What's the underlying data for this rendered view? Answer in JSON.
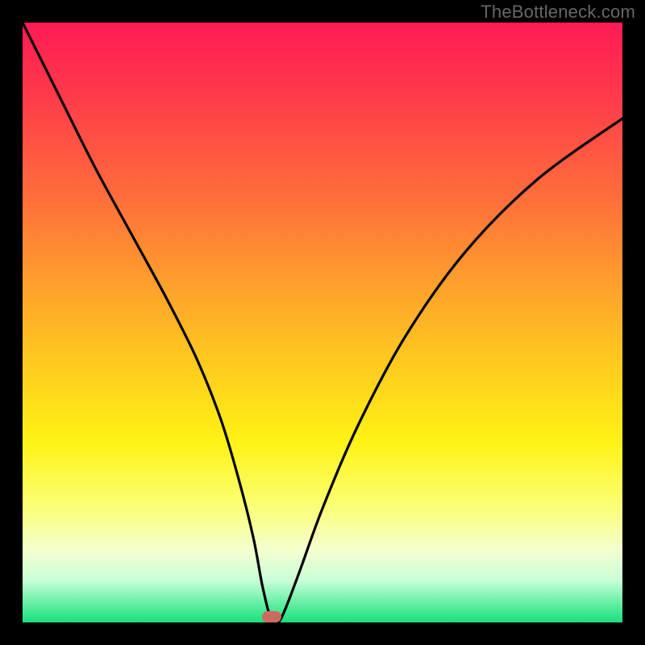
{
  "watermark_text": "TheBottleneck.com",
  "marker": {
    "x_pct": 41.5,
    "y_pct": 99.0,
    "color": "#cc6a60"
  },
  "chart_data": {
    "type": "line",
    "title": "",
    "xlabel": "",
    "ylabel": "",
    "xlim": [
      0,
      100
    ],
    "ylim": [
      0,
      100
    ],
    "grid": false,
    "legend": false,
    "series": [
      {
        "name": "curve",
        "color": "#000000",
        "x": [
          0,
          6,
          12,
          18,
          24,
          29,
          33,
          36,
          38.5,
          40,
          41.5,
          43,
          46,
          50,
          56,
          64,
          74,
          86,
          100
        ],
        "values": [
          100,
          88,
          76,
          65,
          54,
          44,
          34,
          24,
          14,
          6,
          0.5,
          0.5,
          8,
          19,
          33,
          48,
          62,
          74,
          84
        ]
      }
    ],
    "optimum_marker": {
      "x": 41.5,
      "y": 0.5
    },
    "background_gradient": {
      "orientation": "vertical",
      "stops": [
        {
          "pos": 0.0,
          "color": "#ff1a55"
        },
        {
          "pos": 0.28,
          "color": "#ff6a3c"
        },
        {
          "pos": 0.56,
          "color": "#ffc81f"
        },
        {
          "pos": 0.8,
          "color": "#fbff6e"
        },
        {
          "pos": 0.93,
          "color": "#c8ffd8"
        },
        {
          "pos": 1.0,
          "color": "#18e07e"
        }
      ]
    }
  }
}
